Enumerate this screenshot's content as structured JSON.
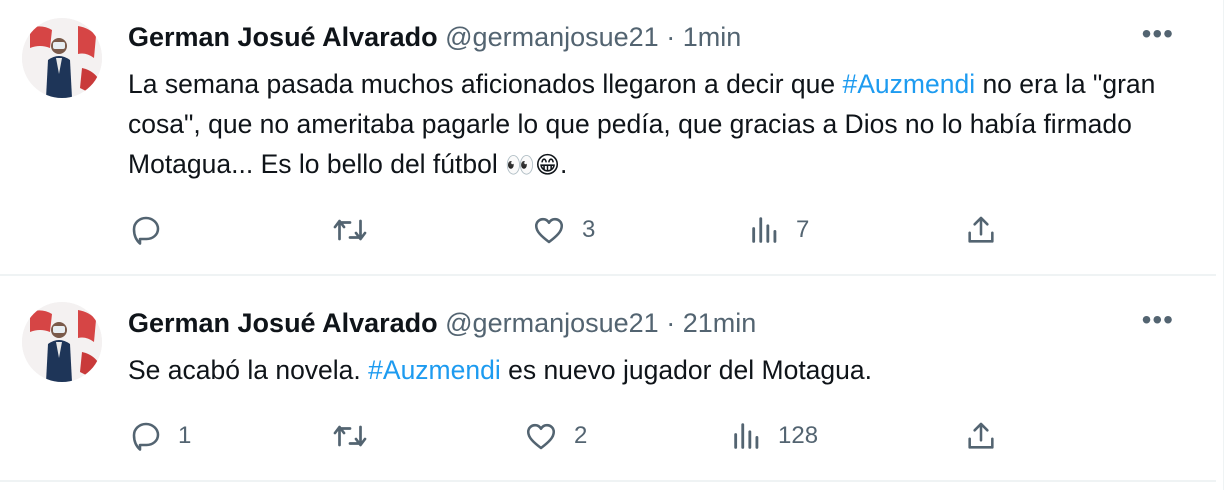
{
  "tweets": [
    {
      "author_name": "German Josué Alvarado",
      "handle": "@germanjosue21",
      "separator": "·",
      "time": "1min",
      "more": "•••",
      "text_parts": [
        "La semana pasada muchos aficionados llegaron a decir que ",
        "#Auzmendi",
        " no era la \"gran cosa\", que no ameritaba pagarle lo que pedía, que gracias a Dios no lo había firmado Motagua... Es lo bello del fútbol ",
        "👀😁",
        "."
      ],
      "counts": {
        "reply": "",
        "retweet": "",
        "like": "3",
        "views": "7"
      }
    },
    {
      "author_name": "German Josué Alvarado",
      "handle": "@germanjosue21",
      "separator": "·",
      "time": "21min",
      "more": "•••",
      "text_parts": [
        "Se acabó la novela.  ",
        "#Auzmendi",
        " es nuevo jugador del Motagua."
      ],
      "counts": {
        "reply": "1",
        "retweet": "",
        "like": "2",
        "views": "128"
      }
    }
  ],
  "icons": {
    "reply": "reply-icon",
    "retweet": "retweet-icon",
    "like": "heart-icon",
    "views": "views-icon",
    "share": "share-icon"
  },
  "colors": {
    "hashtag": "#1d9bf0",
    "secondary_text": "#536471",
    "primary_text": "#0f1419",
    "divider": "#eff3f4"
  }
}
